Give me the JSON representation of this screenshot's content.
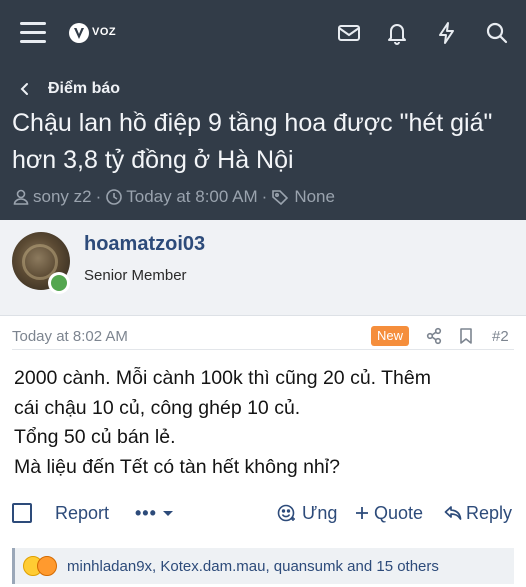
{
  "header": {
    "logo_text": "VOZ",
    "icons": [
      "menu-icon",
      "mail-icon",
      "bell-icon",
      "bolt-icon",
      "search-icon"
    ]
  },
  "breadcrumb": {
    "label": "Điểm báo"
  },
  "thread": {
    "title": "Chậu lan hồ điệp 9 tầng hoa được \"hét giá\" hơn 3,8 tỷ đồng ở Hà Nội",
    "author": "sony z2",
    "time": "Today at 8:00 AM",
    "tags": "None"
  },
  "post": {
    "username": "hoamatzoi03",
    "user_title": "Senior Member",
    "date": "Today at 8:02 AM",
    "badge": "New",
    "number": "#2",
    "body_lines": [
      "2000 cành. Mỗi cành 100k thì cũng 20 củ. Thêm",
      "cái chậu 10 củ, công ghép 10 củ.",
      "Tổng 50 củ bán lẻ.",
      "Mà liệu đến Tết có tàn hết không nhỉ?"
    ],
    "actions": {
      "report": "Report",
      "more": "•••",
      "react": "Ưng",
      "quote": "Quote",
      "reply": "Reply"
    },
    "reactions_text": "minhladan9x, Kotex.dam.mau, quansumk and 15 others"
  },
  "colors": {
    "header_bg": "#323c48",
    "link_blue": "#2d4b7a",
    "new_badge": "#f58e3c",
    "online": "#54a64f"
  }
}
